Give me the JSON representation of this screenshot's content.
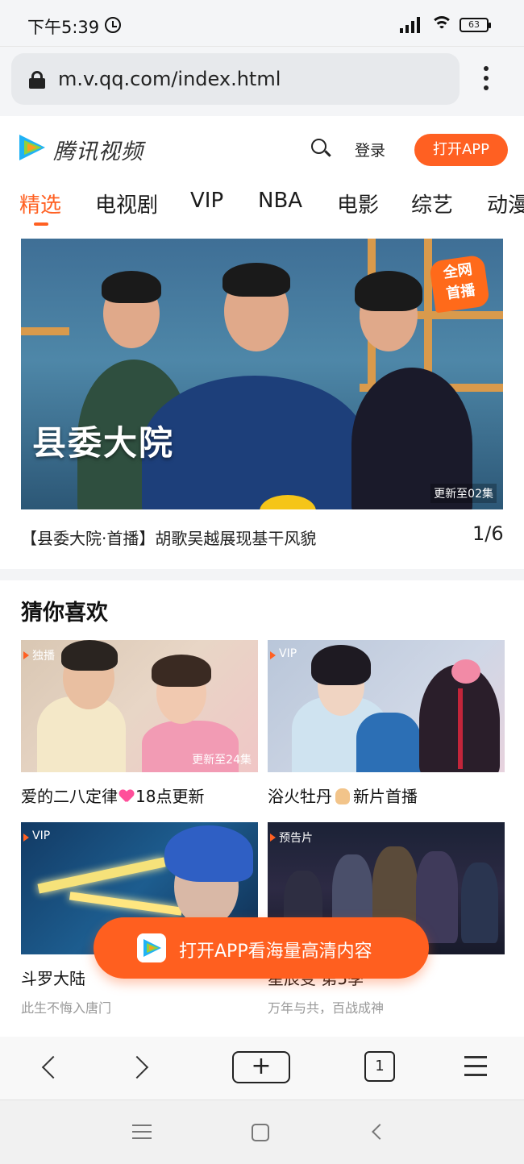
{
  "status_bar": {
    "time": "下午5:39",
    "battery": "63"
  },
  "browser": {
    "url": "m.v.qq.com/index.html"
  },
  "header": {
    "logo_text": "腾讯视频",
    "login_label": "登录",
    "open_app_label": "打开APP"
  },
  "nav_tabs": [
    "精选",
    "电视剧",
    "VIP",
    "NBA",
    "电影",
    "综艺",
    "动漫"
  ],
  "hero": {
    "title": "县委大院",
    "badge_line1": "全网",
    "badge_line2": "首播",
    "episode": "更新至02集",
    "caption": "【县委大院·首播】胡歌吴越展现基干风貌",
    "pager": "1/6"
  },
  "recommend": {
    "title": "猜你喜欢",
    "cards": [
      {
        "tag": "独播",
        "episode": "更新至24集",
        "title_a": "爱的二八定律",
        "title_b": "18点更新",
        "subtitle": ""
      },
      {
        "tag": "VIP",
        "episode": "",
        "title_a": "浴火牡丹",
        "title_b": "新片首播",
        "subtitle": ""
      },
      {
        "tag": "VIP",
        "episode": "",
        "title_a": "斗罗大陆",
        "title_b": "",
        "subtitle": "此生不悔入唐门"
      },
      {
        "tag": "预告片",
        "episode": "",
        "title_a": "星辰变 第5季",
        "title_b": "",
        "subtitle": "万年与共，百战成神"
      }
    ]
  },
  "float_cta": {
    "label": "打开APP看海量高清内容"
  },
  "toolbar": {
    "new_tab": "+",
    "tab_count": "1"
  },
  "colors": {
    "accent": "#ff6022",
    "text": "#1c1c1c",
    "muted": "#999999"
  }
}
